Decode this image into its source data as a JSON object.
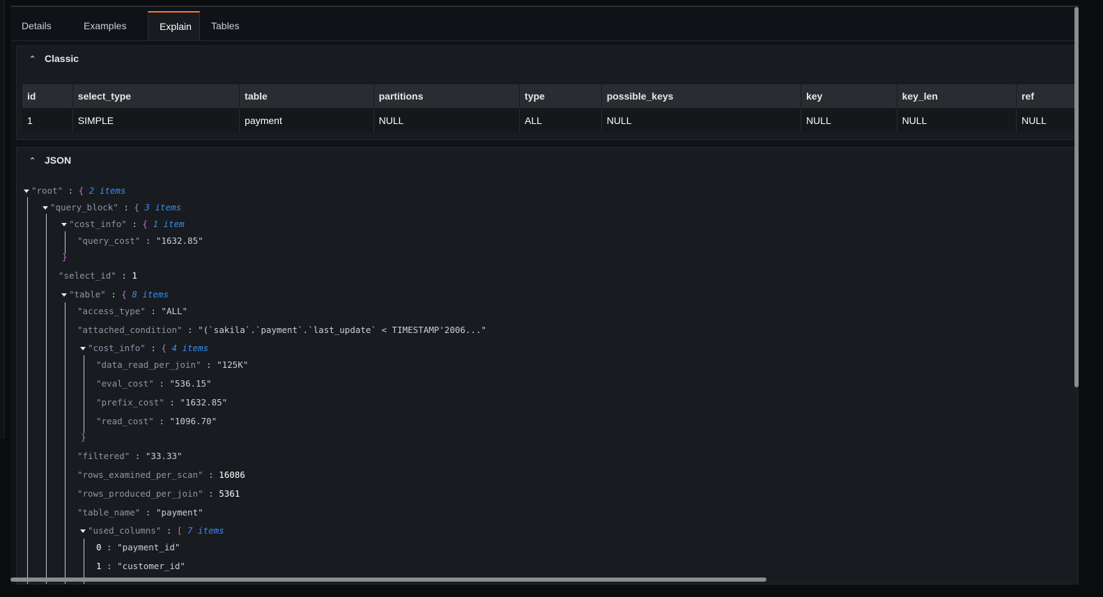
{
  "tabs": [
    {
      "label": "Details",
      "active": false
    },
    {
      "label": "Examples",
      "active": false
    },
    {
      "label": "Explain",
      "active": true
    },
    {
      "label": "Tables",
      "active": false
    }
  ],
  "classic": {
    "title": "Classic",
    "columns": [
      "id",
      "select_type",
      "table",
      "partitions",
      "type",
      "possible_keys",
      "key",
      "key_len",
      "ref"
    ],
    "rows": [
      [
        "1",
        "SIMPLE",
        "payment",
        "NULL",
        "ALL",
        "NULL",
        "NULL",
        "NULL",
        "NULL"
      ]
    ]
  },
  "json_section": {
    "title": "JSON",
    "lines": {
      "root_key": "\"root\"",
      "root_count": "2 items",
      "qb_key": "\"query_block\"",
      "qb_count": "3 items",
      "ci_key": "\"cost_info\"",
      "ci_count": "1 item",
      "qc_key": "\"query_cost\"",
      "qc_val": "\"1632.85\"",
      "sid_key": "\"select_id\"",
      "sid_val": "1",
      "tbl_key": "\"table\"",
      "tbl_count": "8 items",
      "at_key": "\"access_type\"",
      "at_val": "\"ALL\"",
      "ac_key": "\"attached_condition\"",
      "ac_val": "\"(`sakila`.`payment`.`last_update` < TIMESTAMP'2006...\"",
      "ci2_key": "\"cost_info\"",
      "ci2_count": "4 items",
      "drpj_key": "\"data_read_per_join\"",
      "drpj_val": "\"125K\"",
      "ec_key": "\"eval_cost\"",
      "ec_val": "\"536.15\"",
      "pc_key": "\"prefix_cost\"",
      "pc_val": "\"1632.85\"",
      "rc_key": "\"read_cost\"",
      "rc_val": "\"1096.70\"",
      "f_key": "\"filtered\"",
      "f_val": "\"33.33\"",
      "reps_key": "\"rows_examined_per_scan\"",
      "reps_val": "16086",
      "rppj_key": "\"rows_produced_per_join\"",
      "rppj_val": "5361",
      "tn_key": "\"table_name\"",
      "tn_val": "\"payment\"",
      "uc_key": "\"used_columns\"",
      "uc_count": "7 items",
      "uc0_idx": "0",
      "uc0_val": "\"payment_id\"",
      "uc1_idx": "1",
      "uc1_val": "\"customer_id\""
    }
  }
}
